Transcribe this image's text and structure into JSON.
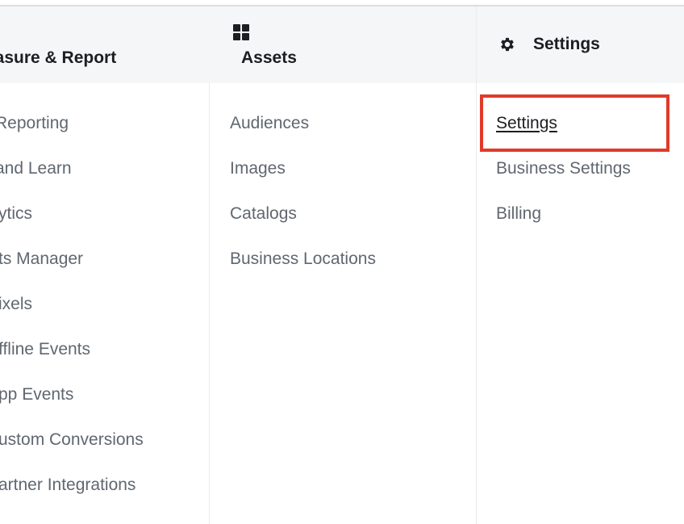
{
  "columns": [
    {
      "id": "measure-report",
      "header": "easure & Report",
      "items": [
        " Reporting",
        " and Learn",
        "ytics",
        "ts Manager",
        "ixels",
        "ffline Events",
        "pp Events",
        "ustom Conversions",
        "artner Integrations"
      ]
    },
    {
      "id": "assets",
      "header": "Assets",
      "icon": "grid-icon",
      "items": [
        "Audiences",
        "Images",
        "Catalogs",
        "Business Locations"
      ]
    },
    {
      "id": "settings",
      "header": "Settings",
      "icon": "gear-icon",
      "items": [
        "Settings",
        "Business Settings",
        "Billing"
      ],
      "active_item": "Settings"
    }
  ],
  "colors": {
    "header_bg": "#f5f6f7",
    "item_text": "#606770",
    "header_text": "#1c1e21",
    "highlight": "#e03a2a"
  }
}
